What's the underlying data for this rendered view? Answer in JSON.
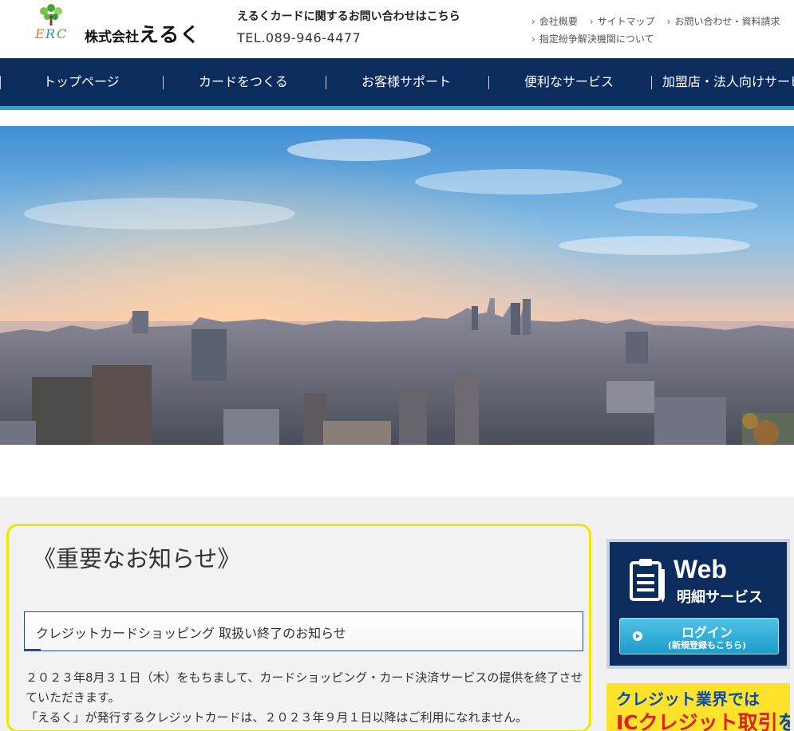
{
  "header": {
    "logo_small": "株式会社",
    "logo_big": "えるく",
    "contact_title": "えるくカードに関するお問い合わせはこちら",
    "contact_tel": "TEL.089-946-4477",
    "links_row1": [
      "会社概要",
      "サイトマップ",
      "お問い合わせ・資料請求"
    ],
    "links_row2": [
      "指定紛争解決機関について"
    ]
  },
  "nav": {
    "items": [
      "トップページ",
      "カードをつくる",
      "お客様サポート",
      "便利なサービス",
      "加盟店・法人向けサービス"
    ]
  },
  "notice": {
    "title": "《重要なお知らせ》",
    "subtitle": "クレジットカードショッピング 取扱い終了のお知らせ",
    "body": [
      "２０２３年8月３１日（木）をもちまして、カードショッピング・カード決済サービスの提供を終了させていただきます。",
      "「えるく」が発行するクレジットカードは、２０２３年９月１日以降はご利用になれません。"
    ]
  },
  "sidebar": {
    "web_title": "Web",
    "web_sub": "明細サービス",
    "login_main": "ログイン",
    "login_sub": "(新規登録もこちら)",
    "ic_line1": "クレジット業界では",
    "ic_line2_red": "ICクレジット取引",
    "ic_line2_rest": "を"
  },
  "colors": {
    "nav_bg": "#0d2c5e",
    "nav_accent": "#2aa7c9",
    "notice_border": "#f2e600",
    "login_button": "#1d9ccd",
    "ic_banner_bg": "#ffe22b"
  }
}
